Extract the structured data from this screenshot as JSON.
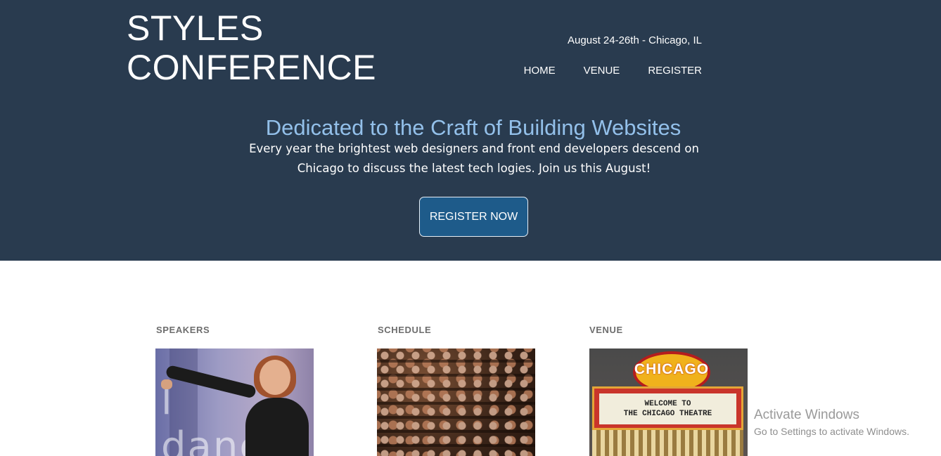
{
  "header": {
    "logo_line1": "STYLES",
    "logo_line2": "CONFERENCE",
    "dateline": "August 24-26th - Chicago, IL",
    "nav": [
      {
        "label": "HOME"
      },
      {
        "label": "VENUE"
      },
      {
        "label": "REGISTER"
      }
    ]
  },
  "hero": {
    "tagline": "Dedicated to the Craft of Building Websites",
    "intro": "Every year the brightest web designers and front end developers descend on Chicago to discuss the latest tech logies. Join us this August!",
    "cta_label": "REGISTER NOW"
  },
  "sections": [
    {
      "title": "SPEAKERS",
      "image_text": "l dance"
    },
    {
      "title": "SCHEDULE"
    },
    {
      "title": "VENUE",
      "image_sign": "CHICAGO",
      "image_board_line1": "WELCOME TO",
      "image_board_line2": "THE CHICAGO THEATRE"
    }
  ],
  "os_watermark": {
    "line1": "Activate Windows",
    "line2": "Go to Settings to activate Windows."
  },
  "colors": {
    "hero_bg": "#293b4f",
    "tagline": "#93c0ea",
    "cta_bg": "#1e5b8a",
    "section_heading": "#6d6d6d"
  }
}
